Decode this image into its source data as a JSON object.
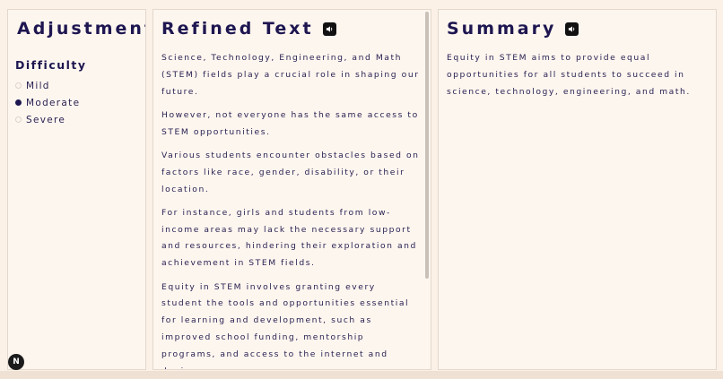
{
  "adjustments": {
    "title": "Adjustments",
    "difficulty_label": "Difficulty",
    "options": [
      {
        "label": "Mild",
        "selected": false
      },
      {
        "label": "Moderate",
        "selected": true
      },
      {
        "label": "Severe",
        "selected": false
      }
    ]
  },
  "refined": {
    "title": "Refined Text",
    "speaker_icon": "speaker-icon",
    "paragraphs": [
      "Science, Technology, Engineering, and Math (STEM) fields play a crucial role in shaping our future.",
      "However, not everyone has the same access to STEM opportunities.",
      "Various students encounter obstacles based on factors like race, gender, disability, or their location.",
      "For instance, girls and students from low-income areas may lack the necessary support and resources, hindering their exploration and achievement in STEM fields.",
      "Equity in STEM involves granting every student the tools and opportunities essential for learning and development, such as improved school funding, mentorship programs, and access to the internet and devices."
    ]
  },
  "summary": {
    "title": "Summary",
    "speaker_icon": "speaker-icon",
    "text": "Equity in STEM aims to provide equal opportunities for all students to succeed in science, technology, engineering, and math."
  },
  "fab": {
    "label": "N"
  },
  "colors": {
    "background": "#fbf1e6",
    "panel": "#fdf6ef",
    "text": "#2a2152",
    "heading": "#1e1650",
    "speaker_button": "#111111"
  }
}
